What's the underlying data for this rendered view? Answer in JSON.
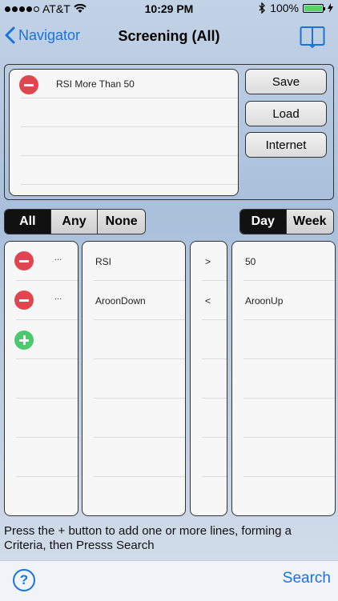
{
  "status_bar": {
    "carrier": "AT&T",
    "time": "10:29 PM",
    "battery": "100%"
  },
  "nav": {
    "back_label": "Navigator",
    "title": "Screening (All)"
  },
  "saved_criteria": [
    {
      "label": "RSI More Than 50"
    }
  ],
  "buttons": {
    "save": "Save",
    "load": "Load",
    "internet": "Internet"
  },
  "match_segment": {
    "options": [
      "All",
      "Any",
      "None"
    ],
    "selected": "All"
  },
  "period_segment": {
    "options": [
      "Day",
      "Week"
    ],
    "selected": "Day"
  },
  "criteria": [
    {
      "more": "...",
      "indicator": "RSI",
      "operator": ">",
      "value": "50"
    },
    {
      "more": "...",
      "indicator": "AroonDown",
      "operator": "<",
      "value": "AroonUp"
    }
  ],
  "hint": "Press the + button to add one or more lines, forming a Criteria, then Presss Search",
  "bottom": {
    "help": "?",
    "search": "Search"
  },
  "colors": {
    "accent": "#1a73d9",
    "remove": "#e0464f",
    "add": "#4cc86e"
  }
}
